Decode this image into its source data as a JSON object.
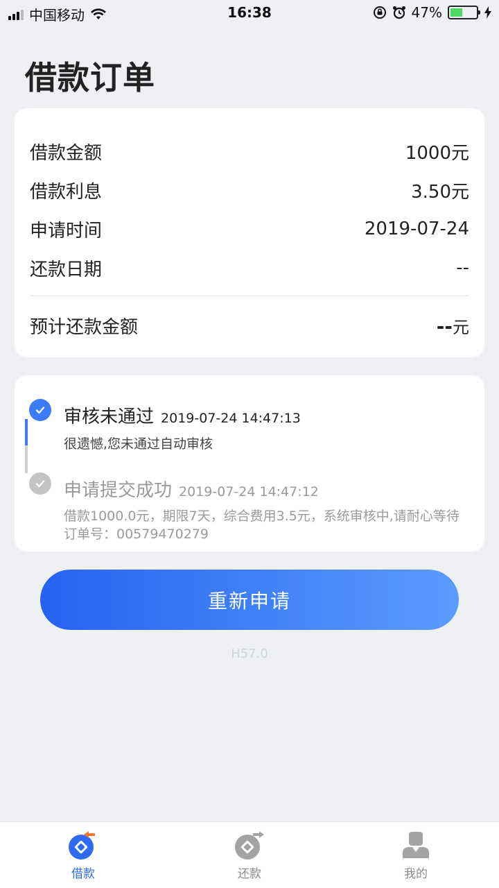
{
  "status_bar": {
    "carrier": "中国移动",
    "time": "16:38",
    "battery_percent": "47%",
    "battery_level": 0.47
  },
  "page": {
    "title": "借款订单"
  },
  "order_info": {
    "rows": [
      {
        "label": "借款金额",
        "value": "1000元"
      },
      {
        "label": "借款利息",
        "value": "3.50元"
      },
      {
        "label": "申请时间",
        "value": "2019-07-24"
      },
      {
        "label": "还款日期",
        "value": "--"
      }
    ],
    "total": {
      "label": "预计还款金额",
      "value": "--",
      "unit": "元"
    }
  },
  "timeline": {
    "items": [
      {
        "status": "审核未通过",
        "time": "2019-07-24 14:47:13",
        "desc": "很遗憾,您未通过自动审核",
        "active": true
      },
      {
        "status": "申请提交成功",
        "time": "2019-07-24 14:47:12",
        "desc": "借款1000.0元，期限7天，综合费用3.5元，系统审核中,请耐心等待 订单号：00579470279",
        "active": false
      }
    ]
  },
  "actions": {
    "reapply_label": "重新申请"
  },
  "version": "H57.0",
  "tabs": [
    {
      "label": "借款",
      "icon": "borrow-icon",
      "active": true
    },
    {
      "label": "还款",
      "icon": "repay-icon",
      "active": false
    },
    {
      "label": "我的",
      "icon": "profile-icon",
      "active": false
    }
  ],
  "colors": {
    "accent": "#2f6bf0",
    "tab_accent_secondary": "#f07a2a",
    "background": "#eef0f4"
  }
}
